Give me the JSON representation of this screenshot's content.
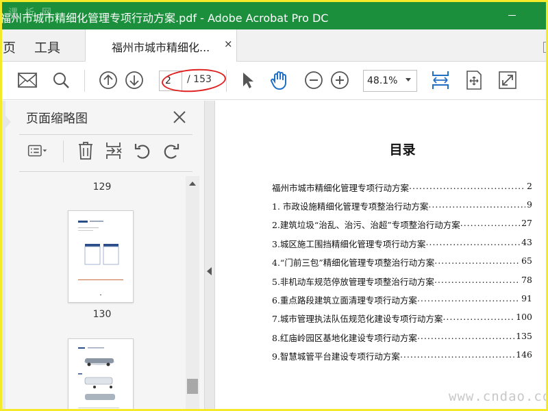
{
  "window": {
    "title": "福州市城市精细化管理专项行动方案.pdf - Adobe Acrobat Pro DC",
    "watermark_tl": "课 析 网",
    "accent_color": "#1b8f3c"
  },
  "tabs": {
    "home_label": "页",
    "tools_label": "工具",
    "doc_label": "福州市城市精细化...",
    "close_glyph": "×"
  },
  "toolbar": {
    "icons": [
      "mail-icon",
      "search-icon",
      "page-up-icon",
      "page-down-icon",
      "select-arrow-icon",
      "hand-icon",
      "zoom-out-icon",
      "zoom-in-icon",
      "fit-width-icon",
      "scroll-mode-icon",
      "fullscreen-icon"
    ],
    "page_current": "2",
    "page_total": "/ 153",
    "zoom": "48.1%",
    "annotation_color": "#e02020"
  },
  "panel": {
    "title": "页面缩略图",
    "thumbnails": [
      {
        "number": "129"
      },
      {
        "number": "130"
      }
    ]
  },
  "document": {
    "toc_title": "目录",
    "toc": [
      {
        "text": "福州市城市精细化管理专项行动方案",
        "page": "2"
      },
      {
        "text": "1.  市政设施精细化管理专项整治行动方案",
        "page": "9"
      },
      {
        "text": "2.建筑垃圾“治乱、治污、治超”专项整治行动方案",
        "page": "27"
      },
      {
        "text": "3.城区施工围挡精细化管理专项行动方案",
        "page": "43"
      },
      {
        "text": "4.“门前三包”精细化管理专项整治行动方案",
        "page": "65"
      },
      {
        "text": "5.非机动车规范停放管理专项整治行动方案",
        "page": "78"
      },
      {
        "text": "6.重点路段建筑立面清理专项行动方案",
        "page": "91"
      },
      {
        "text": "7.城市管理执法队伍规范化建设专项行动方案",
        "page": "100"
      },
      {
        "text": "8.红庙岭园区基地化建设专项行动方案",
        "page": "135"
      },
      {
        "text": "9.智慧城管平台建设专项行动方案",
        "page": "146"
      }
    ],
    "watermark": "www.cndao.com"
  }
}
